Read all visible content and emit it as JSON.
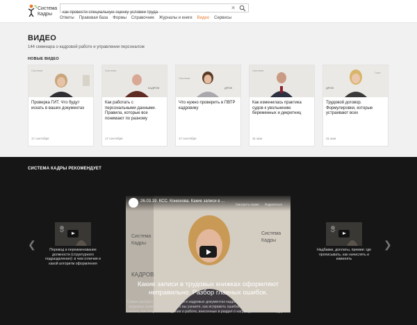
{
  "header": {
    "logo_text_line1": "Система",
    "logo_text_line2": "Кадры",
    "search_value": "как провести специальную оценку условий труда",
    "nav": [
      "Ответы",
      "Правовая база",
      "Формы",
      "Справочник",
      "Журналы и книги",
      "Видео",
      "Сервисы"
    ],
    "nav_active": "Видео",
    "accent": "#e8782a"
  },
  "video": {
    "title": "ВИДЕО",
    "subtitle": "144 семинара о кадровой работе и управлении персоналом",
    "new_label": "НОВЫЕ ВИДЕО",
    "cards": [
      {
        "title": "Проверка ГИТ. Что будут искать в ваших документах",
        "date": "17 сентября"
      },
      {
        "title": "Как работать с персональными данными. Правила, которые все понимают по разному",
        "date": "17 сентября"
      },
      {
        "title": "Что нужно проверить в ПВТР кадровику",
        "date": "17 сентября"
      },
      {
        "title": "Как изменилась практика судов к увольнению беременных и декретниц",
        "date": "31 мая"
      },
      {
        "title": "Трудовой договор. Формулировки, которые устраивают всех",
        "date": "31 мая"
      }
    ]
  },
  "recommend": {
    "title": "СИСТЕМА КАДРЫ РЕКОМЕНДУЕТ",
    "left_caption": "Перевод и переименование должности (структурного подразделения): в чем отличия и какой алгоритм оформления",
    "right_caption": "Надбавки, доплаты, премии: где прописывать, как начислять и изменять",
    "main_video_title": "26.03.19. КСС. Конюхова. Какие записи в ...",
    "watch_later": "Смотреть позже",
    "share": "Поделиться",
    "heading": "Какие записи в трудовых книжках оформляют неправильно. Разбор главных ошибок.",
    "description": "Самые распространенные ошибки в кадровых документах кадровики допускают при заполнении трудовых книжек. В этом видео вы узнаете, как исправить ошибки в титульном листе трудовой книжки, как исправить сведения о работе, внесенные в раздел о награждениях и многое другое."
  }
}
